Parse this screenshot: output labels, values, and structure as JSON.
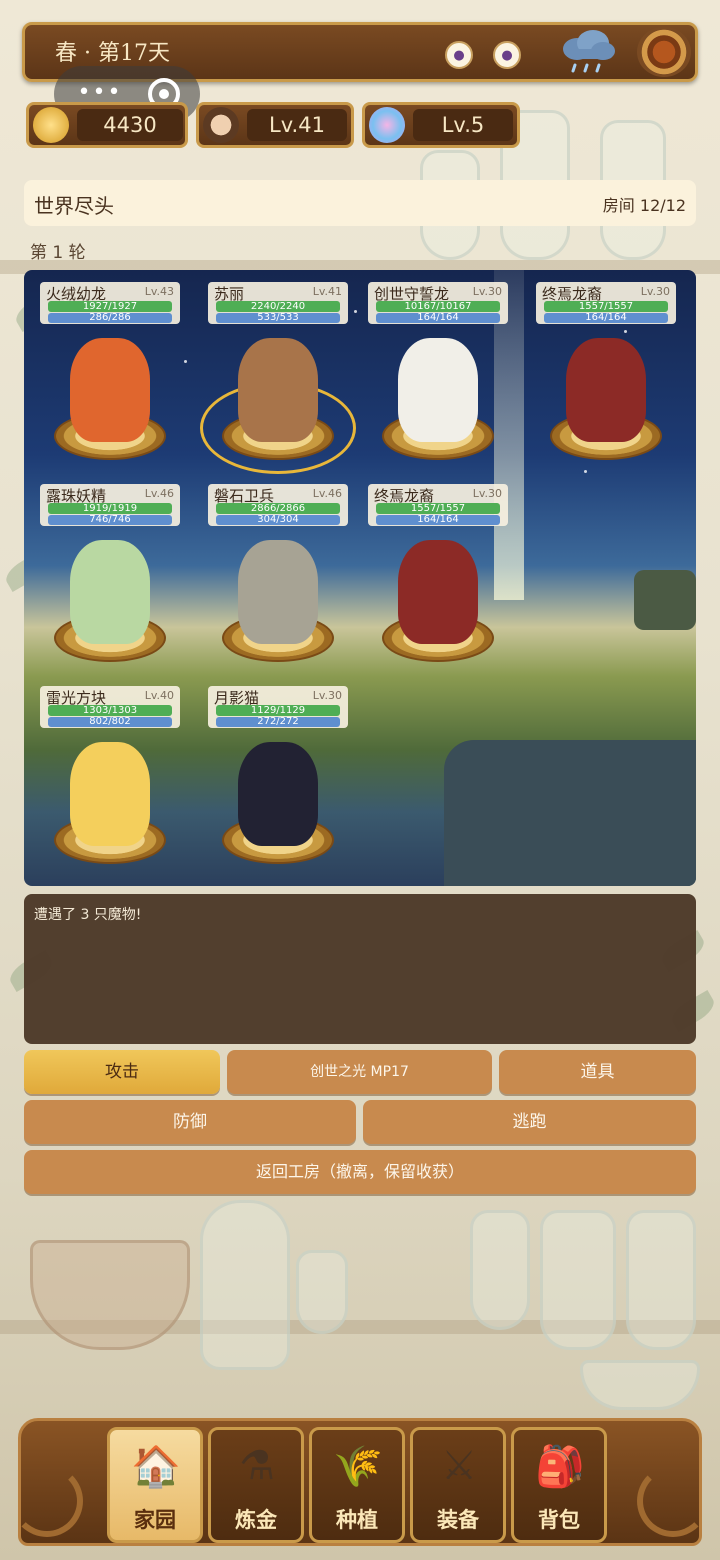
{
  "header": {
    "season_day": "春 · 第17天",
    "icons": [
      "potion-icon",
      "potion-icon",
      "rain-cloud-icon",
      "settings-gear-icon"
    ]
  },
  "capsule": {
    "menu": "•••"
  },
  "stats": {
    "gold": "4430",
    "player_level": "Lv.41",
    "potion_level": "Lv.5"
  },
  "location": {
    "name": "世界尽头",
    "room": "房间 12/12"
  },
  "round": "第 1 轮",
  "units": [
    {
      "name": "火绒幼龙",
      "level": "Lv.43",
      "hp": "1927/1927",
      "mp": "286/286",
      "color": "#e0662e"
    },
    {
      "name": "苏丽",
      "level": "Lv.41",
      "hp": "2240/2240",
      "mp": "533/533",
      "color": "#a8744a"
    },
    {
      "name": "创世守誓龙",
      "level": "Lv.30",
      "hp": "10167/10167",
      "mp": "164/164",
      "color": "#f1efe8"
    },
    {
      "name": "终焉龙裔",
      "level": "Lv.30",
      "hp": "1557/1557",
      "mp": "164/164",
      "color": "#8c2a26"
    },
    {
      "name": "露珠妖精",
      "level": "Lv.46",
      "hp": "1919/1919",
      "mp": "746/746",
      "color": "#b9d8a2"
    },
    {
      "name": "磐石卫兵",
      "level": "Lv.46",
      "hp": "2866/2866",
      "mp": "304/304",
      "color": "#a7a394"
    },
    {
      "name": "终焉龙裔",
      "level": "Lv.30",
      "hp": "1557/1557",
      "mp": "164/164",
      "color": "#8c2a26"
    },
    {
      "name": "雷光方块",
      "level": "Lv.40",
      "hp": "1303/1303",
      "mp": "802/802",
      "color": "#f4cf5c"
    },
    {
      "name": "月影猫",
      "level": "Lv.30",
      "hp": "1129/1129",
      "mp": "272/272",
      "color": "#222233"
    }
  ],
  "log": {
    "text": "遭遇了 3 只魔物!"
  },
  "actions": {
    "attack": "攻击",
    "skill": "创世之光 MP17",
    "item": "道具",
    "defend": "防御",
    "flee": "逃跑",
    "retreat": "返回工房（撤离，保留收获）"
  },
  "nav": [
    {
      "label": "家园",
      "icon": "house-icon",
      "glyph": "🏠",
      "active": true
    },
    {
      "label": "炼金",
      "icon": "cauldron-icon",
      "glyph": "⚗"
    },
    {
      "label": "种植",
      "icon": "wheat-icon",
      "glyph": "🌾"
    },
    {
      "label": "装备",
      "icon": "sword-shield-icon",
      "glyph": "⚔"
    },
    {
      "label": "背包",
      "icon": "backpack-icon",
      "glyph": "🎒"
    }
  ]
}
